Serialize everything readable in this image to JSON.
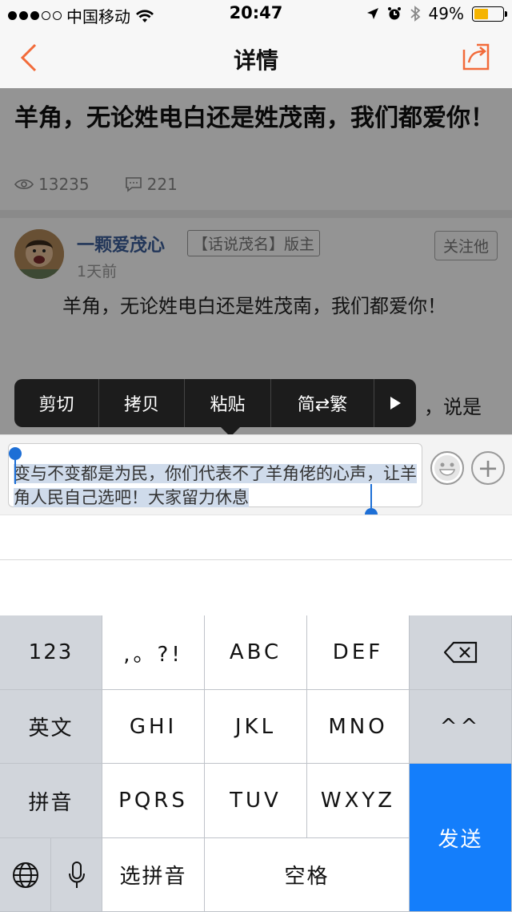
{
  "status": {
    "carrier": "中国移动",
    "time": "20:47",
    "battery": "49%",
    "battery_level": 0.49
  },
  "nav": {
    "title": "详情",
    "back_icon": "chevron-left-icon",
    "share_icon": "share-icon",
    "accent": "#f26b3a"
  },
  "post": {
    "title": "羊角，无论姓电白还是姓茂南，我们都爱你！",
    "views": "13235",
    "comments": "221",
    "author": "一颗爱茂心",
    "role": "【话说茂名】版主",
    "follow": "关注他",
    "time_ago": "1天前",
    "body": "羊角，无论姓电白还是姓茂南，我们都爱你！",
    "body2_visible": "，说是"
  },
  "edit_menu": {
    "items": [
      "剪切",
      "拷贝",
      "粘贴",
      "简⇄繁"
    ],
    "more_icon": "play-icon"
  },
  "compose": {
    "text": "变与不变都是为民，你们代表不了羊角佬的心声，让羊角人民自己选吧！大家留力休息",
    "emoji_icon": "smiley-icon",
    "plus_icon": "plus-icon",
    "selection_color": "#1d6fd6"
  },
  "keyboard": {
    "row1": [
      "123",
      ",。?!",
      "ABC",
      "DEF"
    ],
    "row2": [
      "英文",
      "GHI",
      "JKL",
      "MNO",
      "^^"
    ],
    "row3": [
      "拼音",
      "PQRS",
      "TUV",
      "WXYZ"
    ],
    "row4": [
      "选拼音",
      "空格"
    ],
    "send": "发送",
    "delete_icon": "backspace-icon",
    "globe_icon": "globe-icon",
    "mic_icon": "microphone-icon",
    "send_color": "#147efb"
  }
}
